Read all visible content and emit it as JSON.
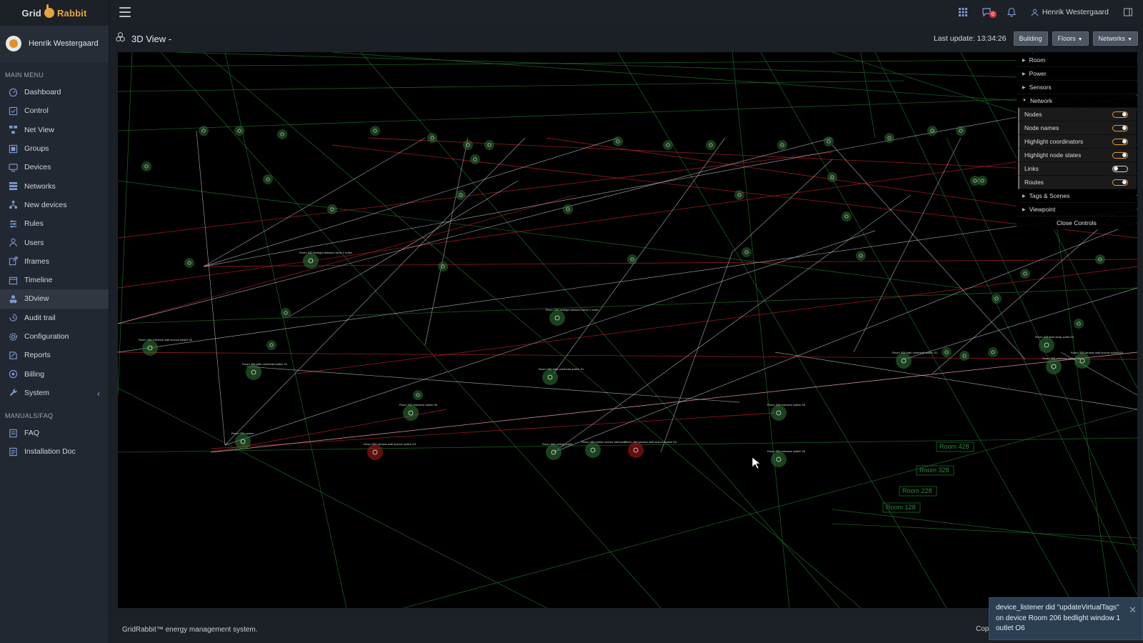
{
  "brand": {
    "part1": "Grid",
    "part2": "Rabbit"
  },
  "user": {
    "name": "Henrik Westergaard"
  },
  "menu": {
    "main_title": "MAIN MENU",
    "items": [
      {
        "label": "Dashboard",
        "icon": "dashboard-icon"
      },
      {
        "label": "Control",
        "icon": "control-icon"
      },
      {
        "label": "Net View",
        "icon": "net-view-icon"
      },
      {
        "label": "Groups",
        "icon": "groups-icon"
      },
      {
        "label": "Devices",
        "icon": "devices-icon"
      },
      {
        "label": "Networks",
        "icon": "networks-icon"
      },
      {
        "label": "New devices",
        "icon": "new-devices-icon"
      },
      {
        "label": "Rules",
        "icon": "rules-icon"
      },
      {
        "label": "Users",
        "icon": "users-icon"
      },
      {
        "label": "Iframes",
        "icon": "iframes-icon"
      },
      {
        "label": "Timeline",
        "icon": "timeline-icon"
      },
      {
        "label": "3Dview",
        "icon": "cubes-icon",
        "active": true
      },
      {
        "label": "Audit trail",
        "icon": "audit-icon"
      },
      {
        "label": "Configuration",
        "icon": "gear-icon"
      },
      {
        "label": "Reports",
        "icon": "reports-icon"
      },
      {
        "label": "Billing",
        "icon": "billing-icon"
      },
      {
        "label": "System",
        "icon": "wrench-icon"
      }
    ],
    "manuals_title": "MANUALS/FAQ",
    "manuals": [
      {
        "label": "FAQ",
        "icon": "faq-icon"
      },
      {
        "label": "Installation Doc",
        "icon": "doc-icon"
      }
    ]
  },
  "topbar": {
    "notifications_count": "0",
    "user_name": "Henrik Westergaard"
  },
  "header": {
    "title": "3D View -",
    "last_update": "Last update: 13:34:26",
    "buttons": {
      "building": "Building",
      "floors": "Floors",
      "networks": "Networks"
    }
  },
  "controls": {
    "folders": {
      "room": "Room",
      "power": "Power",
      "sensors": "Sensors",
      "network": "Network",
      "tags": "Tags & Scenes",
      "viewpoint": "Viewpoint"
    },
    "network_options": [
      {
        "label": "Nodes",
        "on": true
      },
      {
        "label": "Node names",
        "on": true
      },
      {
        "label": "Highlight coordinators",
        "on": true
      },
      {
        "label": "Highlight node states",
        "on": true
      },
      {
        "label": "Links",
        "on": false
      },
      {
        "label": "Routes",
        "on": true
      }
    ],
    "close_label": "Close Controls"
  },
  "scene": {
    "room_labels": [
      "Room 428",
      "Room 328",
      "Room 228",
      "Room 128"
    ],
    "nodes": [
      {
        "label": "Room 333 motion",
        "state": "ok"
      },
      {
        "label": "Room 332 window wall sconce switch S3",
        "state": "alert"
      },
      {
        "label": "Room 330 ceiling outlet",
        "state": "ok"
      },
      {
        "label": "Room 330 motion sensor bathroom",
        "state": "ok"
      },
      {
        "label": "Room 330 window wall sconce switch S3",
        "state": "alert"
      },
      {
        "label": "Room 330 entrance switch S4",
        "state": "ok"
      },
      {
        "label": "Room 332 entrance switch S4",
        "state": "ok"
      },
      {
        "label": "Room 333 bath overhead switch S1",
        "state": "ok"
      },
      {
        "label": "Room 334 entrance wall sconce switch S3",
        "state": "ok"
      },
      {
        "label": "Room 330 bath overhead switch S1",
        "state": "ok"
      },
      {
        "label": "Room 332 bedlight between beds 1 outlet",
        "state": "ok"
      },
      {
        "label": "Room 330 bedlight between beds 1 outlet",
        "state": "ok"
      },
      {
        "label": "Room 328 entrance switch S4",
        "state": "ok"
      },
      {
        "label": "Room 328 bath overhead switch S1",
        "state": "ok"
      },
      {
        "label": "Room 328 floor lamp outlet O1",
        "state": "ok"
      },
      {
        "label": "Room 328 window wall sconce switch S3",
        "state": "ok"
      },
      {
        "label": "Room 328 entrance switch S4",
        "state": "ok"
      }
    ]
  },
  "footer": {
    "text": "GridRabbit™ energy management system.",
    "copy": "Cop"
  },
  "toast": {
    "message": "device_listener did \"updateVirtualTags\" on device Room 206 bedlight window 1 outlet O6"
  }
}
